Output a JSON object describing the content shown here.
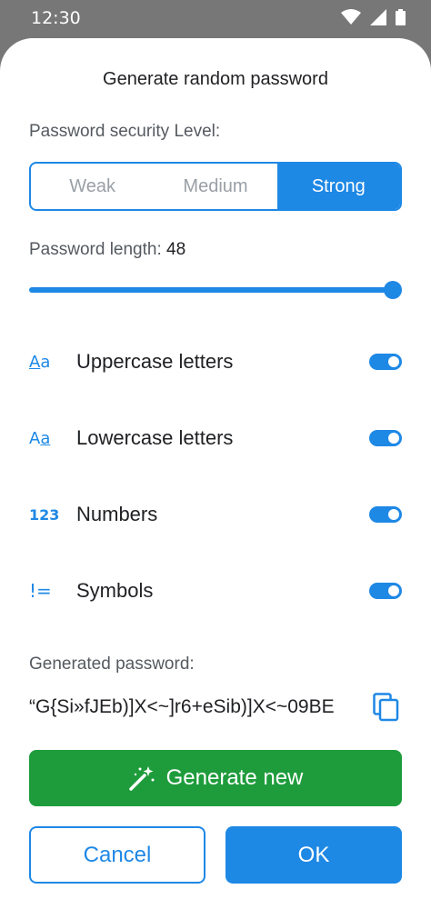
{
  "status_bar": {
    "time": "12:30",
    "icons": [
      "wifi-icon",
      "signal-icon",
      "battery-icon"
    ]
  },
  "dialog": {
    "title": "Generate random password",
    "security_label": "Password security Level:",
    "levels": [
      "Weak",
      "Medium",
      "Strong"
    ],
    "selected_level": "Strong",
    "length_label": "Password length:",
    "length_value": "48",
    "length_fraction": 1.0,
    "options": [
      {
        "icon_text": "Aa",
        "icon": "uppercase-icon",
        "label": "Uppercase letters",
        "enabled": true
      },
      {
        "icon_text": "Aa",
        "icon": "lowercase-icon",
        "label": "Lowercase letters",
        "enabled": true
      },
      {
        "icon_text": "123",
        "icon": "numbers-icon",
        "label": "Numbers",
        "enabled": true
      },
      {
        "icon_text": "!=",
        "icon": "symbols-icon",
        "label": "Symbols",
        "enabled": true
      }
    ],
    "generated_label": "Generated password:",
    "generated_password": "“G{Si»fJEb)]X<~]r6+eSib)]X<~09BE",
    "generate_button": "Generate new",
    "cancel_button": "Cancel",
    "ok_button": "OK"
  },
  "colors": {
    "accent": "#1e88e5",
    "generate": "#1e9c3c",
    "status_bar": "#777777"
  }
}
